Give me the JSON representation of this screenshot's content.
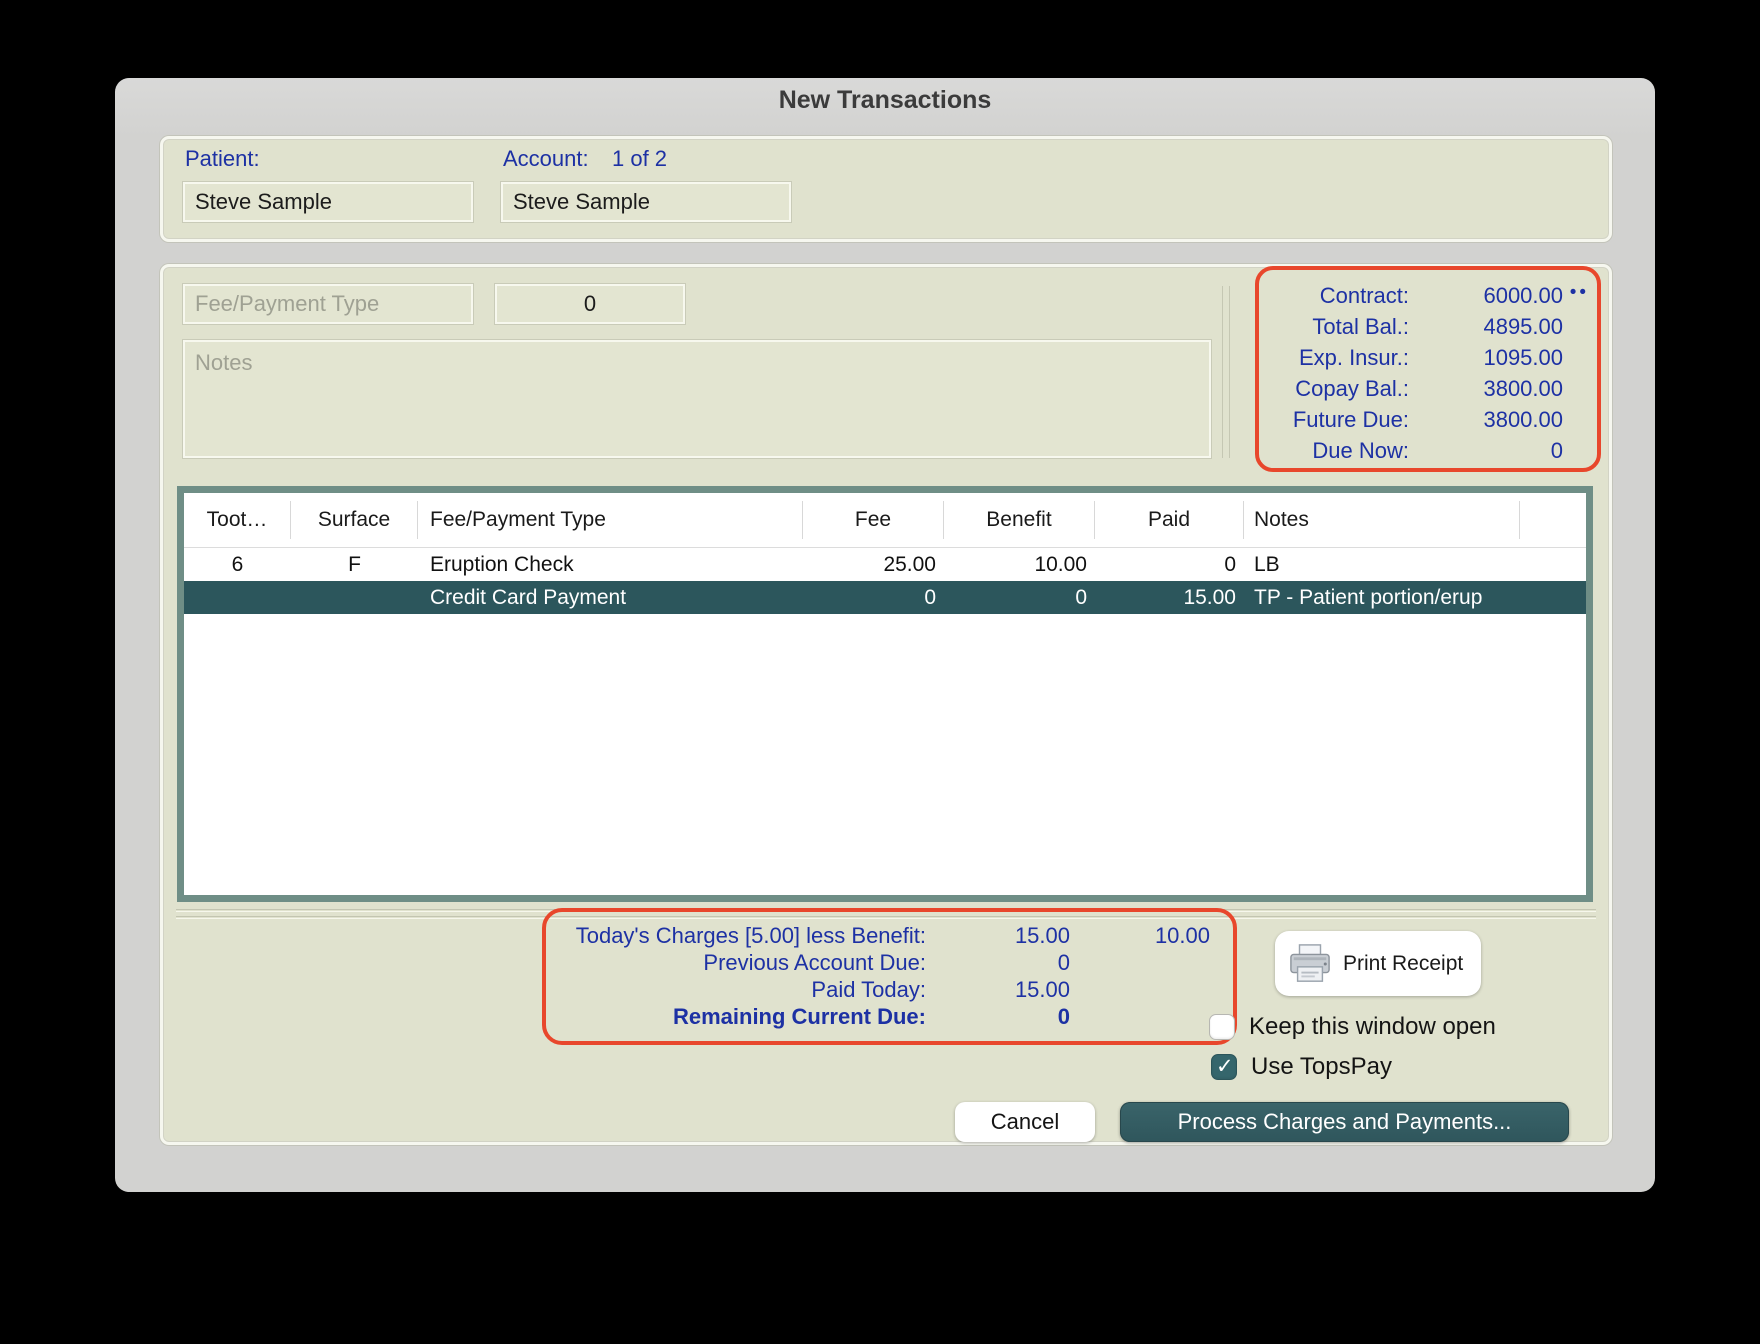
{
  "window": {
    "title": "New Transactions"
  },
  "patient_section": {
    "patient_label": "Patient:",
    "patient_value": "Steve Sample",
    "account_label": "Account:",
    "account_count": "1 of 2",
    "account_value": "Steve Sample"
  },
  "entry": {
    "fee_type_placeholder": "Fee/Payment Type",
    "amount_value": "0",
    "notes_placeholder": "Notes"
  },
  "contract_summary": {
    "more_dots": "••",
    "rows": [
      {
        "label": "Contract:",
        "value": "6000.00"
      },
      {
        "label": "Total Bal.:",
        "value": "4895.00"
      },
      {
        "label": "Exp. Insur.:",
        "value": "1095.00"
      },
      {
        "label": "Copay Bal.:",
        "value": "3800.00"
      },
      {
        "label": "Future Due:",
        "value": "3800.00"
      },
      {
        "label": "Due Now:",
        "value": "0"
      }
    ]
  },
  "transactions_table": {
    "columns": [
      "Toot…",
      "Surface",
      "Fee/Payment Type",
      "Fee",
      "Benefit",
      "Paid",
      "Notes"
    ],
    "rows": [
      {
        "tooth": "6",
        "surface": "F",
        "type": "Eruption Check",
        "fee": "25.00",
        "benefit": "10.00",
        "paid": "0",
        "notes": "LB",
        "selected": false
      },
      {
        "tooth": "",
        "surface": "",
        "type": "Credit Card Payment",
        "fee": "0",
        "benefit": "0",
        "paid": "15.00",
        "notes": "TP - Patient portion/erup",
        "selected": true
      }
    ]
  },
  "totals": {
    "rows": [
      {
        "label": "Today's Charges [5.00] less Benefit:",
        "value": "15.00",
        "value2": "10.00",
        "bold": false
      },
      {
        "label": "Previous Account Due:",
        "value": "0",
        "value2": "",
        "bold": false
      },
      {
        "label": "Paid Today:",
        "value": "15.00",
        "value2": "",
        "bold": false
      },
      {
        "label": "Remaining Current Due:",
        "value": "0",
        "value2": "",
        "bold": true
      }
    ]
  },
  "actions": {
    "print_receipt_label": "Print Receipt",
    "keep_open": {
      "label": "Keep this window open",
      "checked": false
    },
    "use_topspay": {
      "label": "Use TopsPay",
      "checked": true
    },
    "cancel_label": "Cancel",
    "process_label": "Process Charges and Payments..."
  },
  "colors": {
    "accent_outline_red": "#e8472c",
    "label_navy": "#1d31a4",
    "selected_row_teal": "#2c565c",
    "table_border_sage": "#6f8e86",
    "process_button_teal": "#33595f",
    "checkbox_checked_teal": "#35666c",
    "panel_olive": "#e0e2ce"
  }
}
